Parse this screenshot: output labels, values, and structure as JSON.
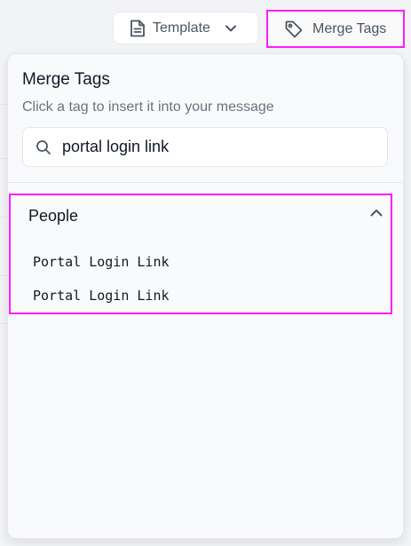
{
  "toolbar": {
    "template_label": "Template",
    "merge_tags_label": "Merge Tags"
  },
  "popover": {
    "title": "Merge Tags",
    "subtitle": "Click a tag to insert it into your message",
    "search": {
      "value": "portal login link",
      "placeholder": ""
    },
    "groups": [
      {
        "title": "People",
        "expanded": true,
        "items": [
          {
            "label": "Portal Login Link"
          },
          {
            "label": "Portal Login Link"
          }
        ]
      }
    ]
  },
  "icons": {
    "template": "document-icon",
    "template_chevron": "chevron-down-icon",
    "merge_tags": "tag-icon",
    "search": "search-icon",
    "group_toggle": "chevron-up-icon"
  },
  "colors": {
    "highlight": "#ff1aff",
    "text_primary": "#111827",
    "text_secondary": "#6b7280",
    "icon": "#4b5563"
  }
}
